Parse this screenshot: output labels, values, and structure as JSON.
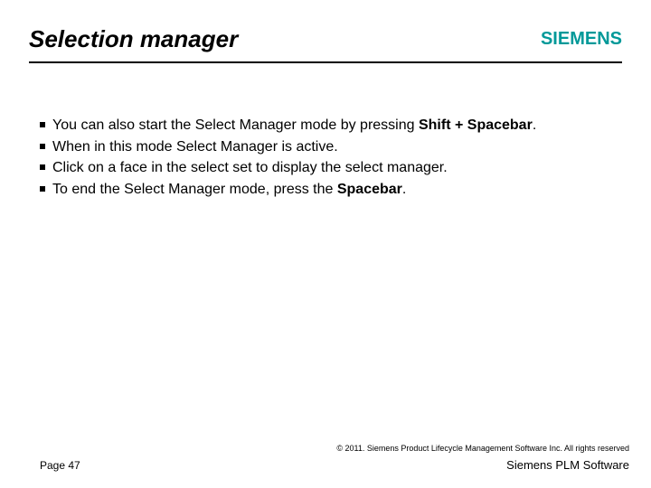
{
  "header": {
    "title": "Selection manager",
    "logo_text": "SIEMENS"
  },
  "body": {
    "bullets": [
      {
        "pre": "You can also start the Select Manager mode by pressing ",
        "bold": "Shift + Spacebar",
        "post": "."
      },
      {
        "pre": "When in this mode Select Manager is active.",
        "bold": "",
        "post": ""
      },
      {
        "pre": "Click on a face in the select set to display the select manager.",
        "bold": "",
        "post": ""
      },
      {
        "pre": "To end the Select Manager mode, press the ",
        "bold": "Spacebar",
        "post": "."
      }
    ]
  },
  "footer": {
    "copyright": "© 2011. Siemens Product Lifecycle Management Software Inc. All rights reserved",
    "page": "Page 47",
    "brand": "Siemens PLM Software"
  }
}
